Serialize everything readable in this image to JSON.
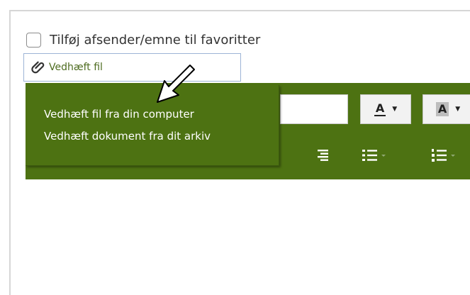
{
  "favorite": {
    "label": "Tilføj afsender/emne til favoritter",
    "checked": false
  },
  "attach": {
    "label": "Vedhæft fil",
    "icon": "paperclip-icon"
  },
  "attach_menu": {
    "items": [
      {
        "label": "Vedhæft fil fra din computer"
      },
      {
        "label": "Vedhæft dokument fra dit arkiv"
      }
    ]
  },
  "toolbar": {
    "text_color_label": "A",
    "background_color_label": "A",
    "icons": [
      "align-right-icon",
      "bullet-list-icon",
      "numbered-list-icon"
    ]
  },
  "colors": {
    "brand_green": "#4d7212",
    "link_green": "#4d6b1f",
    "white": "#ffffff"
  }
}
